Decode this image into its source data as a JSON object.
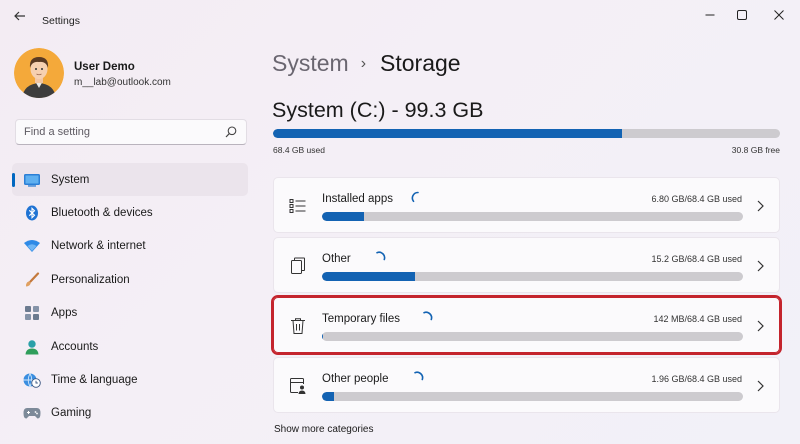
{
  "window": {
    "title": "Settings"
  },
  "user": {
    "name": "User Demo",
    "email": "m__lab@outlook.com"
  },
  "search": {
    "placeholder": "Find a setting"
  },
  "nav": {
    "items": [
      {
        "label": "System",
        "icon": "laptop-icon",
        "active": true
      },
      {
        "label": "Bluetooth & devices",
        "icon": "bluetooth-icon",
        "active": false
      },
      {
        "label": "Network & internet",
        "icon": "wifi-icon",
        "active": false
      },
      {
        "label": "Personalization",
        "icon": "brush-icon",
        "active": false
      },
      {
        "label": "Apps",
        "icon": "apps-icon",
        "active": false
      },
      {
        "label": "Accounts",
        "icon": "accounts-icon",
        "active": false
      },
      {
        "label": "Time & language",
        "icon": "globe-clock-icon",
        "active": false
      },
      {
        "label": "Gaming",
        "icon": "gamepad-icon",
        "active": false
      }
    ]
  },
  "breadcrumb": {
    "parent": "System",
    "separator": "›",
    "current": "Storage"
  },
  "drive": {
    "title": "System (C:) - 99.3 GB",
    "used_label": "68.4 GB used",
    "free_label": "30.8 GB free",
    "used_fraction": 0.689
  },
  "categories": [
    {
      "label": "Installed apps",
      "size": "6.80 GB/68.4 GB used",
      "fraction": 0.099,
      "icon": "installed-apps-icon",
      "highlight": false
    },
    {
      "label": "Other",
      "size": "15.2 GB/68.4 GB used",
      "fraction": 0.222,
      "icon": "other-files-icon",
      "highlight": false
    },
    {
      "label": "Temporary files",
      "size": "142 MB/68.4 GB used",
      "fraction": 0.002,
      "icon": "trash-icon",
      "highlight": true
    },
    {
      "label": "Other people",
      "size": "1.96 GB/68.4 GB used",
      "fraction": 0.029,
      "icon": "other-people-icon",
      "highlight": false
    }
  ],
  "more_link": "Show more categories",
  "colors": {
    "accent": "#1363b3",
    "highlight_border": "#c4242d",
    "bar_track": "#cdcbcf"
  }
}
